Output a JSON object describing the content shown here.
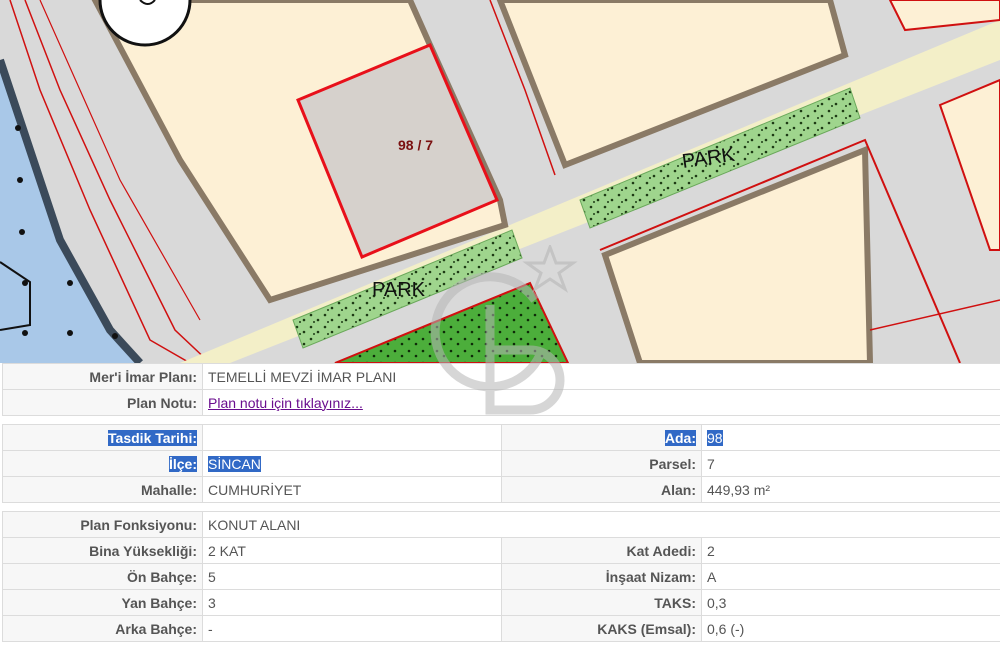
{
  "map": {
    "parcel_label": "98 / 7",
    "park_label_1": "PARK",
    "park_label_2": "PARK",
    "colors": {
      "road": "#d9d9d9",
      "residential": "#fdf0d5",
      "building_border": "#8a7a66",
      "parcel_fill": "#d6d1cc",
      "parcel_border": "#e8101a",
      "park": "#9fd58d",
      "park_dark": "#4cae3b",
      "water": "#a9c8e8",
      "boundary_red": "#d01010",
      "avenue": "#f3efc8"
    },
    "icons": [
      "north-arrow-icon",
      "watermark-logo-icon"
    ]
  },
  "info": {
    "rows": [
      {
        "label": "Mer'i İmar Planı:",
        "value": "TEMELLİ MEVZİ İMAR PLANI"
      },
      {
        "label": "Plan Notu:",
        "link": "Plan notu için tıklayınız..."
      }
    ],
    "tasdik": {
      "label": "Tasdik Tarihi:",
      "value": ""
    },
    "ada": {
      "label": "Ada:",
      "value": "98"
    },
    "ilce": {
      "label": "İlçe:",
      "value": "SİNCAN"
    },
    "parsel": {
      "label": "Parsel:",
      "value": "7"
    },
    "mahalle": {
      "label": "Mahalle:",
      "value": "CUMHURİYET"
    },
    "alan": {
      "label": "Alan:",
      "value": "449,93 m²"
    },
    "fonksiyon": {
      "label": "Plan Fonksiyonu:",
      "value": "KONUT ALANI"
    },
    "bina": {
      "label": "Bina Yüksekliği:",
      "value": "2 KAT"
    },
    "kat": {
      "label": "Kat Adedi:",
      "value": "2"
    },
    "on": {
      "label": "Ön Bahçe:",
      "value": "5"
    },
    "nizam": {
      "label": "İnşaat Nizam:",
      "value": "A"
    },
    "yan": {
      "label": "Yan Bahçe:",
      "value": "3"
    },
    "taks": {
      "label": "TAKS:",
      "value": "0,3"
    },
    "arka": {
      "label": "Arka Bahçe:",
      "value": "-"
    },
    "kaks": {
      "label": "KAKS (Emsal):",
      "value": "0,6 (-)"
    }
  }
}
